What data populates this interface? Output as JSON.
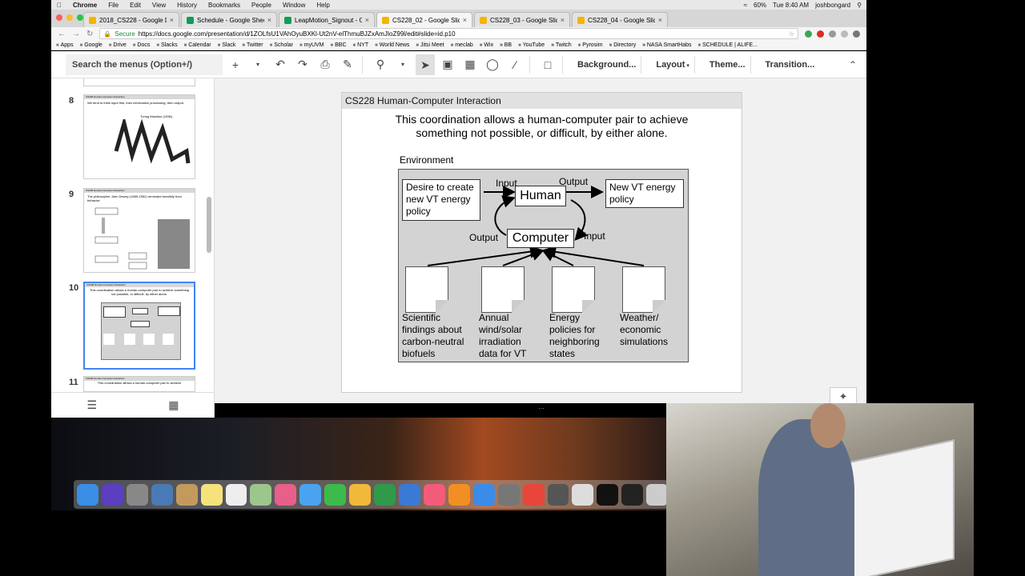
{
  "mac_menu": {
    "items": [
      "Chrome",
      "File",
      "Edit",
      "View",
      "History",
      "Bookmarks",
      "People",
      "Window",
      "Help"
    ],
    "battery": "60%",
    "clock": "Tue 8:40 AM",
    "user": "joshbongard"
  },
  "tabs": [
    {
      "label": "2018_CS228 - Google Drive",
      "color": "#f4b400"
    },
    {
      "label": "Schedule - Google Sheets",
      "color": "#0f9d58"
    },
    {
      "label": "LeapMotion_Signout - Google",
      "color": "#0f9d58"
    },
    {
      "label": "CS228_02 - Google Slides",
      "color": "#f4b400"
    },
    {
      "label": "CS228_03 - Google Slides",
      "color": "#f4b400"
    },
    {
      "label": "CS228_04 - Google Slides",
      "color": "#f4b400"
    }
  ],
  "address": {
    "secure_label": "Secure",
    "url": "https://docs.google.com/presentation/d/1ZOLfsU1VAhOyuBXKl-Ut2nV-elThmuBJZxAmJIoZ99l/edit#slide=id.p10"
  },
  "bookmarks": [
    "Apps",
    "Google",
    "Drive",
    "Docs",
    "Slacks",
    "Calendar",
    "Slack",
    "Twitter",
    "Scholar",
    "myUVM",
    "BBC",
    "NYT",
    "World News",
    "Jitsi Meet",
    "meclab",
    "Wix",
    "BB",
    "YouTube",
    "Twitch",
    "Pyrosim",
    "Directory",
    "NASA SmartHabs",
    "SCHEDULE | ALIFE..."
  ],
  "toolbar": {
    "search_placeholder": "Search the menus (Option+/)",
    "background": "Background...",
    "layout": "Layout",
    "theme": "Theme...",
    "transition": "Transition..."
  },
  "filmstrip": {
    "numbers": [
      "8",
      "9",
      "10",
      "11"
    ],
    "thumb_titles": [
      "CS228 Human-Computer Interaction",
      "CS228 Human-Computer Interaction",
      "CS228 Human-Computer Interaction",
      "CS228 Human-Computer Interaction"
    ],
    "thumb8_text": "We tend to think input first, then information processing, then output.",
    "thumb8_caption": "Turing Machine (1936)",
    "thumb9_text": "The philosopher John Dewey (1859-1952) reminded breathily from behavior:",
    "thumb11_text": "This coordination allows a human-computer pair to achieve"
  },
  "slide": {
    "header": "CS228 Human-Computer Interaction",
    "title_line1": "This coordination allows a human-computer pair to achieve",
    "title_line2": "something not possible, or difficult, by either alone.",
    "environment": "Environment",
    "desire": "Desire to create new VT energy policy",
    "new_policy": "New VT energy policy",
    "human": "Human",
    "computer": "Computer",
    "input_top": "Input",
    "output_top": "Output",
    "output_left": "Output",
    "input_right": "Input",
    "docs": [
      "Scientific findings about carbon-neutral biofuels",
      "Annual wind/solar irradiation data for VT",
      "Energy policies for neighboring states",
      "Weather/ economic simulations"
    ]
  }
}
